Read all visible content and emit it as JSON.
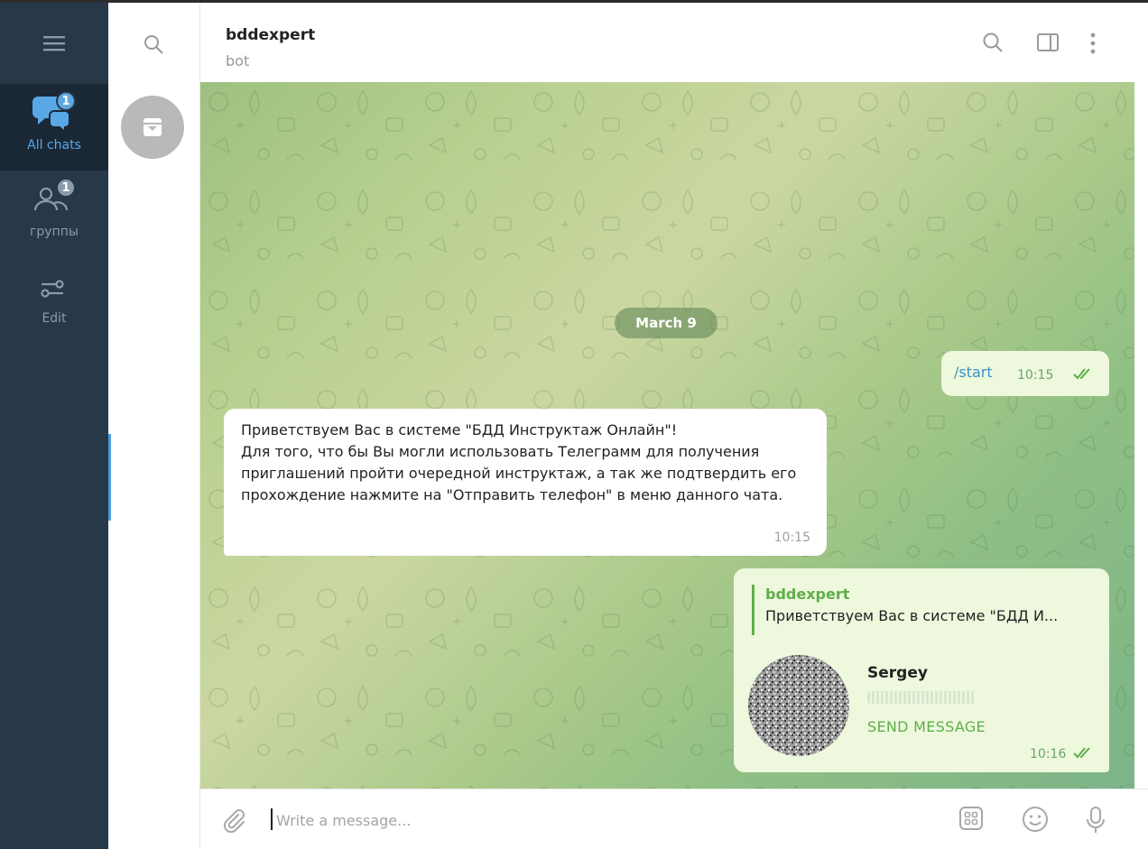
{
  "sidebar": {
    "menu_icon": "hamburger-menu-icon",
    "folders": [
      {
        "label": "All chats",
        "badge": "1",
        "icon": "chats-icon",
        "active": true
      },
      {
        "label": "группы",
        "badge": "1",
        "icon": "group-icon",
        "active": false
      },
      {
        "label": "Edit",
        "icon": "edit-folders-icon",
        "active": false
      }
    ]
  },
  "chatlist": {
    "search_icon": "search-icon",
    "archive_icon": "archive-icon"
  },
  "header": {
    "title": "bddexpert",
    "subtitle": "bot",
    "icons": [
      "search-icon",
      "sidebar-toggle-icon",
      "more-vertical-icon"
    ]
  },
  "messages": {
    "date": "March 9",
    "outgoing_start": {
      "text": "/start",
      "time": "10:15"
    },
    "incoming": {
      "text": "Приветствуем Вас в системе \"БДД Инструктаж Онлайн\"!\nДля того, что бы Вы могли использовать Телеграмм для получения приглашений пройти очередной инструктаж, а так же подтвердить его прохождение нажмите на \"Отправить телефон\" в меню данного чата.",
      "time": "10:15"
    },
    "outgoing_contact": {
      "reply_name": "bddexpert",
      "reply_text": "Приветствуем Вас в системе \"БДД И...",
      "contact_name": "Sergey",
      "action": "SEND MESSAGE",
      "time": "10:16"
    }
  },
  "composer": {
    "placeholder": "Write a message...",
    "icons": [
      "attach-icon",
      "bot-keyboard-icon",
      "emoji-icon",
      "microphone-icon"
    ]
  },
  "colors": {
    "sidebar_bg": "#273849",
    "accent": "#58a8e8",
    "outgoing_bubble": "#eef8dd",
    "green_text": "#5fae4b"
  }
}
